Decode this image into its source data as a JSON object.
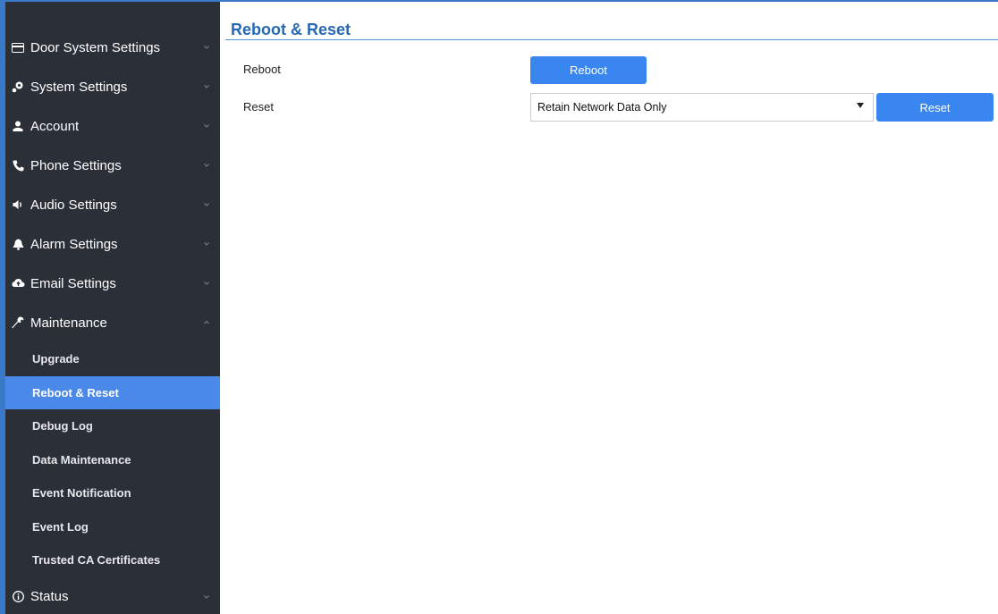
{
  "sidebar": {
    "menu": [
      {
        "label": "Door System Settings",
        "icon": "card-icon"
      },
      {
        "label": "System Settings",
        "icon": "settings-icon"
      },
      {
        "label": "Account",
        "icon": "user-icon"
      },
      {
        "label": "Phone Settings",
        "icon": "phone-icon"
      },
      {
        "label": "Audio Settings",
        "icon": "speaker-icon"
      },
      {
        "label": "Alarm Settings",
        "icon": "bell-icon"
      },
      {
        "label": "Email Settings",
        "icon": "cloud-upload-icon"
      },
      {
        "label": "Maintenance",
        "icon": "wrench-icon",
        "expanded": true
      }
    ],
    "maintenance_items": [
      {
        "label": "Upgrade"
      },
      {
        "label": "Reboot & Reset",
        "active": true
      },
      {
        "label": "Debug Log"
      },
      {
        "label": "Data Maintenance"
      },
      {
        "label": "Event Notification"
      },
      {
        "label": "Event Log"
      },
      {
        "label": "Trusted CA Certificates"
      }
    ],
    "status": {
      "label": "Status",
      "icon": "info-icon"
    }
  },
  "main": {
    "title": "Reboot & Reset",
    "reboot": {
      "label": "Reboot",
      "button_label": "Reboot"
    },
    "reset": {
      "label": "Reset",
      "selected_option": "Retain Network Data Only",
      "button_label": "Reset"
    }
  },
  "colors": {
    "sidebar_bg": "#2b2f38",
    "active_bg": "#4a88e9",
    "accent": "#3a86f0",
    "title": "#2668b4"
  }
}
